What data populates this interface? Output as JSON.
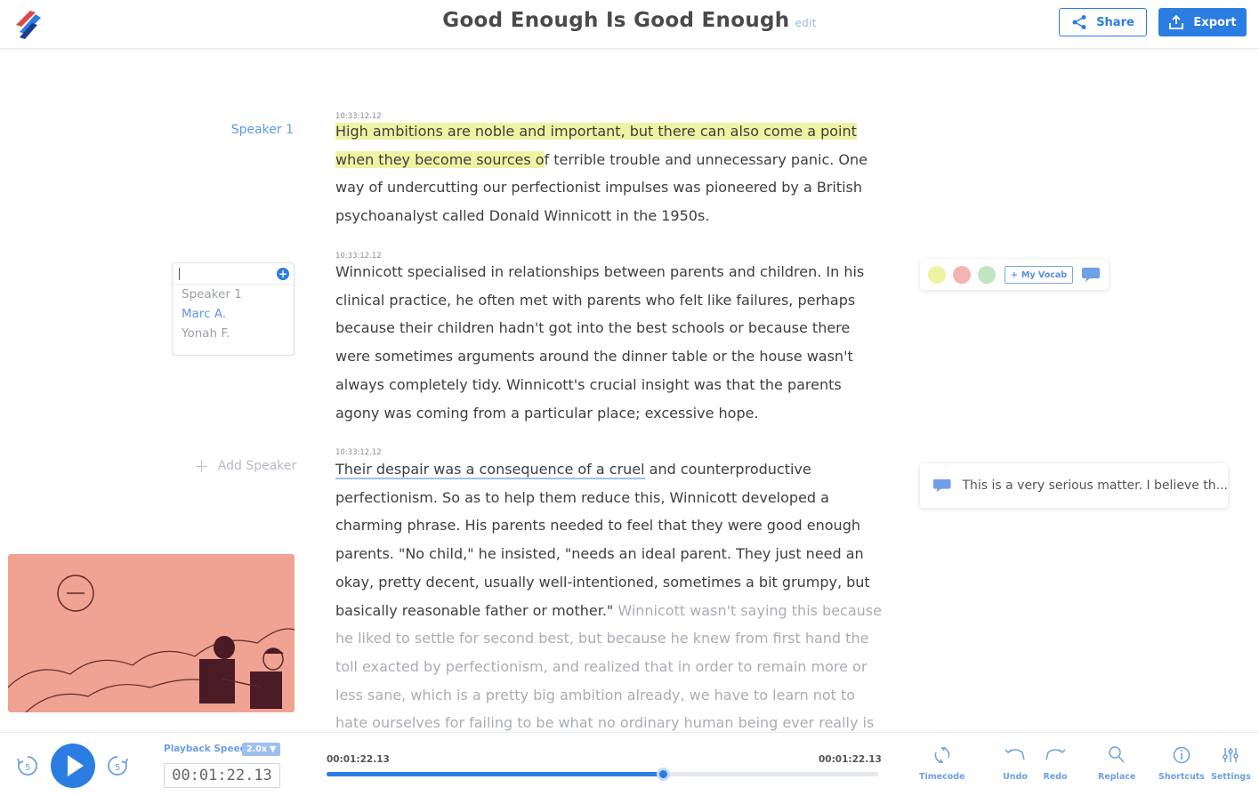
{
  "header": {
    "title": "Good Enough Is Good Enough",
    "edit_label": "edit",
    "share_label": "Share",
    "export_label": "Export"
  },
  "speakers": {
    "first_label": "Speaker 1",
    "options": [
      "Speaker 1",
      "Marc A.",
      "Yonah F."
    ],
    "add_label": "Add Speaker"
  },
  "transcript": [
    {
      "timecode": "10:33:12.12",
      "highlighted_a": "High ambitions are noble and important, but there can also come a point",
      "highlighted_b": "when they become sources o",
      "rest": "f terrible trouble and unnecessary panic. One way of undercutting our perfectionist impulses was pioneered by a British psychoanalyst called Donald Winnicott in the 1950s."
    },
    {
      "timecode": "10:33:12.12",
      "text": "Winnicott specialised in relationships between parents and children. In his clinical practice, he often met with parents who felt like failures, perhaps because their children hadn't got into the best schools or because there were sometimes arguments around the dinner table or the house wasn't always completely tidy. Winnicott's crucial insight was that the parents agony was coming from a particular place; excessive hope."
    },
    {
      "timecode": "10:33:12.12",
      "underlined": "Their despair was a consequence of a cruel",
      "text": " and counterproductive perfectionism. So as to help them reduce this, Winnicott developed a charming phrase. His parents needed to feel that they were good enough parents. \"No child,\" he insisted, \"needs an ideal parent. They just need an okay, pretty decent, usually well-intentioned, sometimes a bit grumpy, but basically reasonable father or mother.\"",
      "faded": " Winnicott wasn't saying this because he liked to settle for second best, but because he knew from first hand the toll exacted by perfectionism, and realized that in order to remain more or less sane, which is a pretty big ambition already, we have to learn not to hate ourselves for failing to be what no ordinary human being ever really is"
    }
  ],
  "highlight_bar": {
    "colors": [
      "#eef3a4",
      "#f4b4b4",
      "#bfe6bf"
    ],
    "vocab_label": "My Vocab"
  },
  "comment": {
    "text": "This is a very serious matter. I believe th..."
  },
  "player": {
    "rewind_seconds": "5",
    "forward_seconds": "5",
    "speed_label": "Playback Speed",
    "speed_value": "2.0x",
    "current_time": "00:01:22.13",
    "elapsed": "00:01:22.13",
    "total": "00:01:22.13",
    "progress": 0.61
  },
  "tools": [
    {
      "label": "Timecode",
      "icon": "timecode-icon"
    },
    {
      "label": "Undo",
      "icon": "undo-icon"
    },
    {
      "label": "Redo",
      "icon": "redo-icon"
    },
    {
      "label": "Replace",
      "icon": "search-icon"
    },
    {
      "label": "Shortcuts",
      "icon": "info-icon"
    },
    {
      "label": "Settings",
      "icon": "sliders-icon"
    }
  ],
  "colors": {
    "accent": "#2b7de1",
    "highlight": "#eef3a4",
    "video_bg": "#f0a293"
  }
}
